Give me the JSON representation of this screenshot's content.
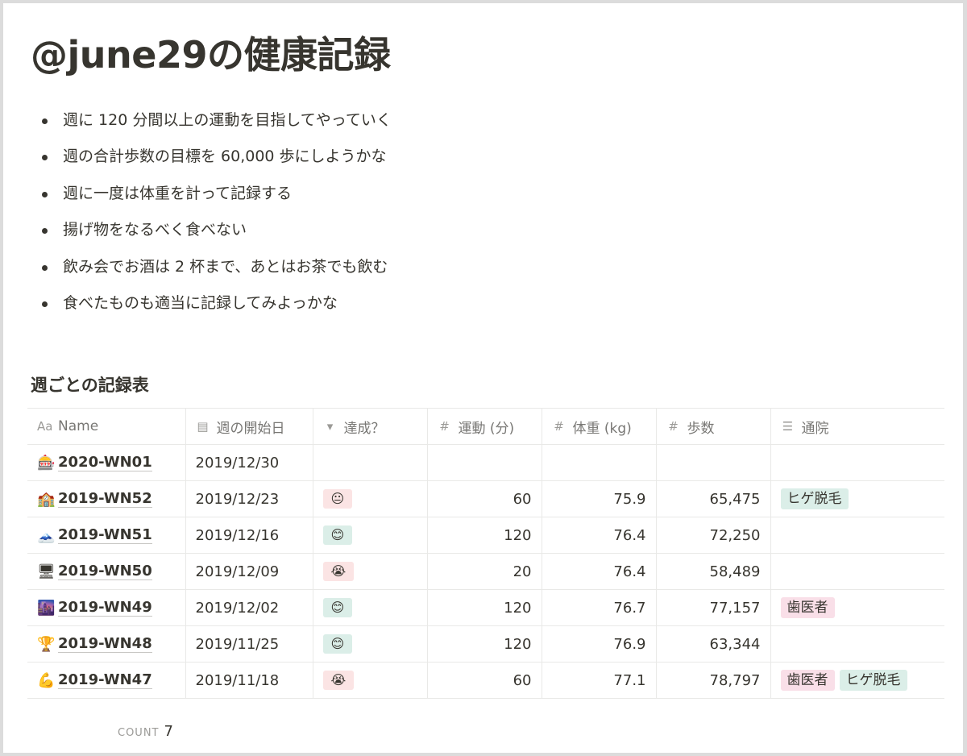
{
  "title": "@june29の健康記録",
  "bullets": [
    "週に 120 分間以上の運動を目指してやっていく",
    "週の合計歩数の目標を 60,000 歩にしようかな",
    "週に一度は体重を計って記録する",
    "揚げ物をなるべく食べない",
    "飲み会でお酒は 2 杯まで、あとはお茶でも飲む",
    "食べたものも適当に記録してみよっかな"
  ],
  "section_title": "週ごとの記録表",
  "table": {
    "headers": [
      {
        "icon": "Aa",
        "label": "Name"
      },
      {
        "icon": "▤",
        "label": "週の開始日"
      },
      {
        "icon": "▾",
        "label": "達成？"
      },
      {
        "icon": "#",
        "label": "運動 (分)"
      },
      {
        "icon": "#",
        "label": "体重 (kg)"
      },
      {
        "icon": "#",
        "label": "歩数"
      },
      {
        "icon": "☰",
        "label": "通院"
      }
    ],
    "rows": [
      {
        "icon": "🎰",
        "name": "2020-WN01",
        "date": "2019/12/30",
        "status": "",
        "status_kind": "",
        "exercise": "",
        "weight": "",
        "steps": "",
        "tags": []
      },
      {
        "icon": "🏫",
        "name": "2019-WN52",
        "date": "2019/12/23",
        "status": "😐",
        "status_kind": "neutral",
        "exercise": "60",
        "weight": "75.9",
        "steps": "65,475",
        "tags": [
          {
            "label": "ヒゲ脱毛",
            "color": "green"
          }
        ]
      },
      {
        "icon": "🗻",
        "name": "2019-WN51",
        "date": "2019/12/16",
        "status": "😊",
        "status_kind": "good",
        "exercise": "120",
        "weight": "76.4",
        "steps": "72,250",
        "tags": []
      },
      {
        "icon": "🖥",
        "name": "2019-WN50",
        "date": "2019/12/09",
        "status": "😭",
        "status_kind": "bad",
        "exercise": "20",
        "weight": "76.4",
        "steps": "58,489",
        "tags": []
      },
      {
        "icon": "🌆",
        "name": "2019-WN49",
        "date": "2019/12/02",
        "status": "😊",
        "status_kind": "good",
        "exercise": "120",
        "weight": "76.7",
        "steps": "77,157",
        "tags": [
          {
            "label": "歯医者",
            "color": "pink"
          }
        ]
      },
      {
        "icon": "🏆",
        "name": "2019-WN48",
        "date": "2019/11/25",
        "status": "😊",
        "status_kind": "good",
        "exercise": "120",
        "weight": "76.9",
        "steps": "63,344",
        "tags": []
      },
      {
        "icon": "💪",
        "name": "2019-WN47",
        "date": "2019/11/18",
        "status": "😭",
        "status_kind": "bad",
        "exercise": "60",
        "weight": "77.1",
        "steps": "78,797",
        "tags": [
          {
            "label": "歯医者",
            "color": "pink"
          },
          {
            "label": "ヒゲ脱毛",
            "color": "green"
          }
        ]
      }
    ]
  },
  "footer": {
    "count_label": "COUNT",
    "count_value": "7"
  },
  "colors": {
    "text": "#37352f",
    "muted": "#787774",
    "tag_green": "#dbeee8",
    "tag_pink": "#f9dfe8",
    "status_red": "#fbe4e4"
  }
}
